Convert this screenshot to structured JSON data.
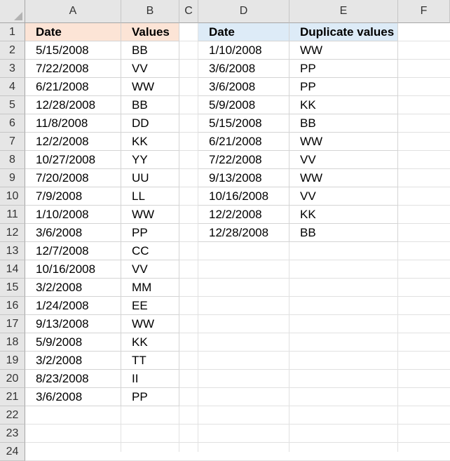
{
  "columns": [
    "A",
    "B",
    "C",
    "D",
    "E",
    "F"
  ],
  "row_numbers": [
    "1",
    "2",
    "3",
    "4",
    "5",
    "6",
    "7",
    "8",
    "9",
    "10",
    "11",
    "12",
    "13",
    "14",
    "15",
    "16",
    "17",
    "18",
    "19",
    "20",
    "21",
    "22",
    "23",
    "24"
  ],
  "table1": {
    "headers": [
      "Date",
      "Values"
    ],
    "header_fill": "#fce4d6",
    "rows": [
      [
        "5/15/2008",
        "BB"
      ],
      [
        "7/22/2008",
        "VV"
      ],
      [
        "6/21/2008",
        "WW"
      ],
      [
        "12/28/2008",
        "BB"
      ],
      [
        "11/8/2008",
        "DD"
      ],
      [
        "12/2/2008",
        "KK"
      ],
      [
        "10/27/2008",
        "YY"
      ],
      [
        "7/20/2008",
        "UU"
      ],
      [
        "7/9/2008",
        "LL"
      ],
      [
        "1/10/2008",
        "WW"
      ],
      [
        "3/6/2008",
        "PP"
      ],
      [
        "12/7/2008",
        "CC"
      ],
      [
        "10/16/2008",
        "VV"
      ],
      [
        "3/2/2008",
        "MM"
      ],
      [
        "1/24/2008",
        "EE"
      ],
      [
        "9/13/2008",
        "WW"
      ],
      [
        "5/9/2008",
        "KK"
      ],
      [
        "3/2/2008",
        "TT"
      ],
      [
        "8/23/2008",
        "II"
      ],
      [
        "3/6/2008",
        "PP"
      ]
    ]
  },
  "table2": {
    "headers": [
      "Date",
      "Duplicate values"
    ],
    "header_fill": "#ddebf7",
    "rows": [
      [
        "1/10/2008",
        "WW"
      ],
      [
        "3/6/2008",
        "PP"
      ],
      [
        "3/6/2008",
        "PP"
      ],
      [
        "5/9/2008",
        "KK"
      ],
      [
        "5/15/2008",
        "BB"
      ],
      [
        "6/21/2008",
        "WW"
      ],
      [
        "7/22/2008",
        "VV"
      ],
      [
        "9/13/2008",
        "WW"
      ],
      [
        "10/16/2008",
        "VV"
      ],
      [
        "12/2/2008",
        "KK"
      ],
      [
        "12/28/2008",
        "BB"
      ]
    ]
  }
}
